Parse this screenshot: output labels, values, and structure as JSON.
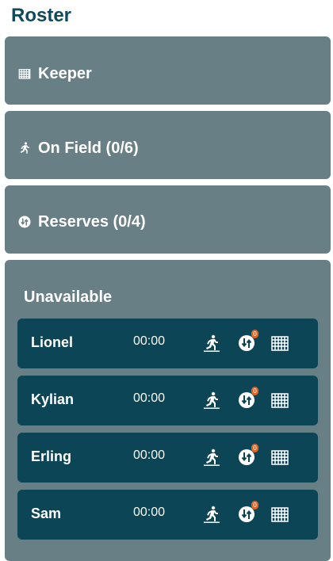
{
  "page": {
    "title": "Roster"
  },
  "sections": {
    "keeper": {
      "label": "Keeper",
      "icon": "goal-net-icon"
    },
    "on_field": {
      "label": "On Field (0/6)",
      "icon": "running-player-icon"
    },
    "reserves": {
      "label": "Reserves (0/4)",
      "icon": "substitution-icon"
    },
    "unavailable": {
      "label": "Unavailable"
    }
  },
  "players": [
    {
      "name": "Lionel",
      "time": "00:00",
      "sub_badge": "0"
    },
    {
      "name": "Kylian",
      "time": "00:00",
      "sub_badge": "0"
    },
    {
      "name": "Erling",
      "time": "00:00",
      "sub_badge": "0"
    },
    {
      "name": "Sam",
      "time": "00:00",
      "sub_badge": "0"
    }
  ],
  "colors": {
    "title": "#0f4a5c",
    "section_bg": "#687f86",
    "player_row_bg": "#0c4556",
    "badge": "#e8631f"
  }
}
